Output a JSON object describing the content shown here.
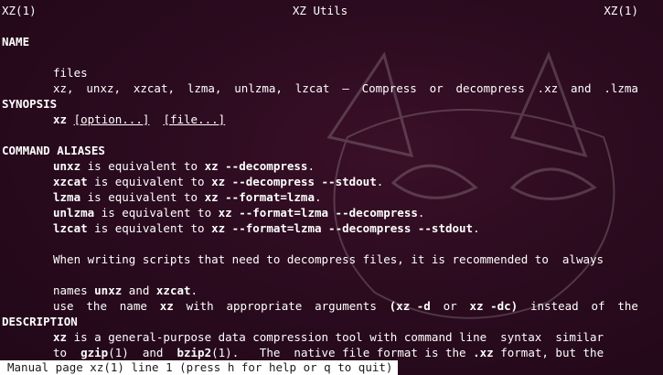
{
  "header": {
    "left": "XZ(1)",
    "center": "XZ Utils",
    "right": "XZ(1)"
  },
  "sections": {
    "name": {
      "heading": "NAME",
      "line1_words": [
        "xz,",
        "unxz,",
        "xzcat,",
        "lzma,",
        "unlzma,",
        "lzcat",
        "–",
        "Compress",
        "or",
        "decompress",
        ".xz",
        "and",
        ".lzma"
      ],
      "line2": "files"
    },
    "synopsis": {
      "heading": "SYNOPSIS",
      "command": "xz",
      "option": "[option...]",
      "file": "[file...]"
    },
    "aliases": {
      "heading": "COMMAND ALIASES",
      "items": [
        {
          "name": "unxz",
          "mid": " is equivalent to ",
          "cmd": "xz --decompress",
          "end": "."
        },
        {
          "name": "xzcat",
          "mid": " is equivalent to ",
          "cmd": "xz --decompress --stdout",
          "end": "."
        },
        {
          "name": "lzma",
          "mid": " is equivalent to ",
          "cmd": "xz --format=lzma",
          "end": "."
        },
        {
          "name": "unlzma",
          "mid": " is equivalent to ",
          "cmd": "xz --format=lzma --decompress",
          "end": "."
        },
        {
          "name": "lzcat",
          "mid": " is equivalent to ",
          "cmd": "xz --format=lzma --decompress --stdout",
          "end": "."
        }
      ],
      "para_line1": "When writing scripts that need to decompress files, it is recommended to  always",
      "para_line2_words": [
        "use",
        "the",
        "name",
        "xz",
        "with",
        "appropriate",
        "arguments",
        "(xz -d",
        "or",
        "xz -dc)",
        "instead",
        "of",
        "the"
      ],
      "para_line3": {
        "a": "names ",
        "b": "unxz",
        "c": " and ",
        "d": "xzcat",
        "e": "."
      }
    },
    "description": {
      "heading": "DESCRIPTION",
      "line1": {
        "cmd": "xz",
        "rest": " is a general-purpose data compression tool with command line  syntax  similar"
      },
      "line2": {
        "a": "to  ",
        "gzip": "gzip",
        "b": "(1)  and  ",
        "bzip2": "bzip2",
        "c": "(1).   The  native file format is the ",
        "xzfmt": ".xz",
        "d": " format, but the"
      }
    }
  },
  "status_bar": {
    "text": "Manual page xz(1) line 1 (press h for help or q to quit)"
  }
}
